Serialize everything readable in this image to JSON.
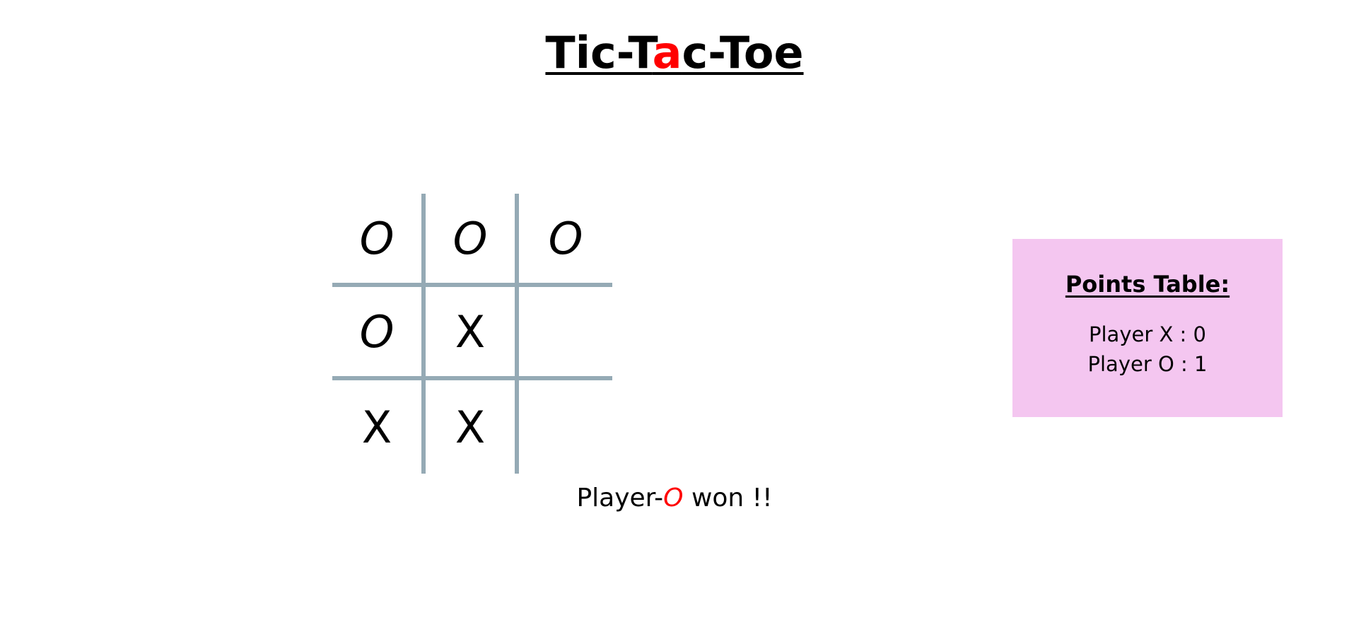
{
  "title": {
    "part1": "Tic-T",
    "accent": "a",
    "part2": "c-Toe"
  },
  "board": {
    "cells": [
      "O",
      "O",
      "O",
      "O",
      "X",
      "",
      "X",
      "X",
      ""
    ]
  },
  "status": {
    "prefix": "Player-",
    "winner": "O",
    "suffix": " won !!"
  },
  "points_table": {
    "heading": "Points Table:",
    "player_x_label": "Player X : ",
    "player_x_score": "0",
    "player_o_label": "Player O : ",
    "player_o_score": "1"
  },
  "colors": {
    "grid_line": "#95aab5",
    "accent": "#ff0000",
    "panel_bg": "#f4c6f0"
  }
}
